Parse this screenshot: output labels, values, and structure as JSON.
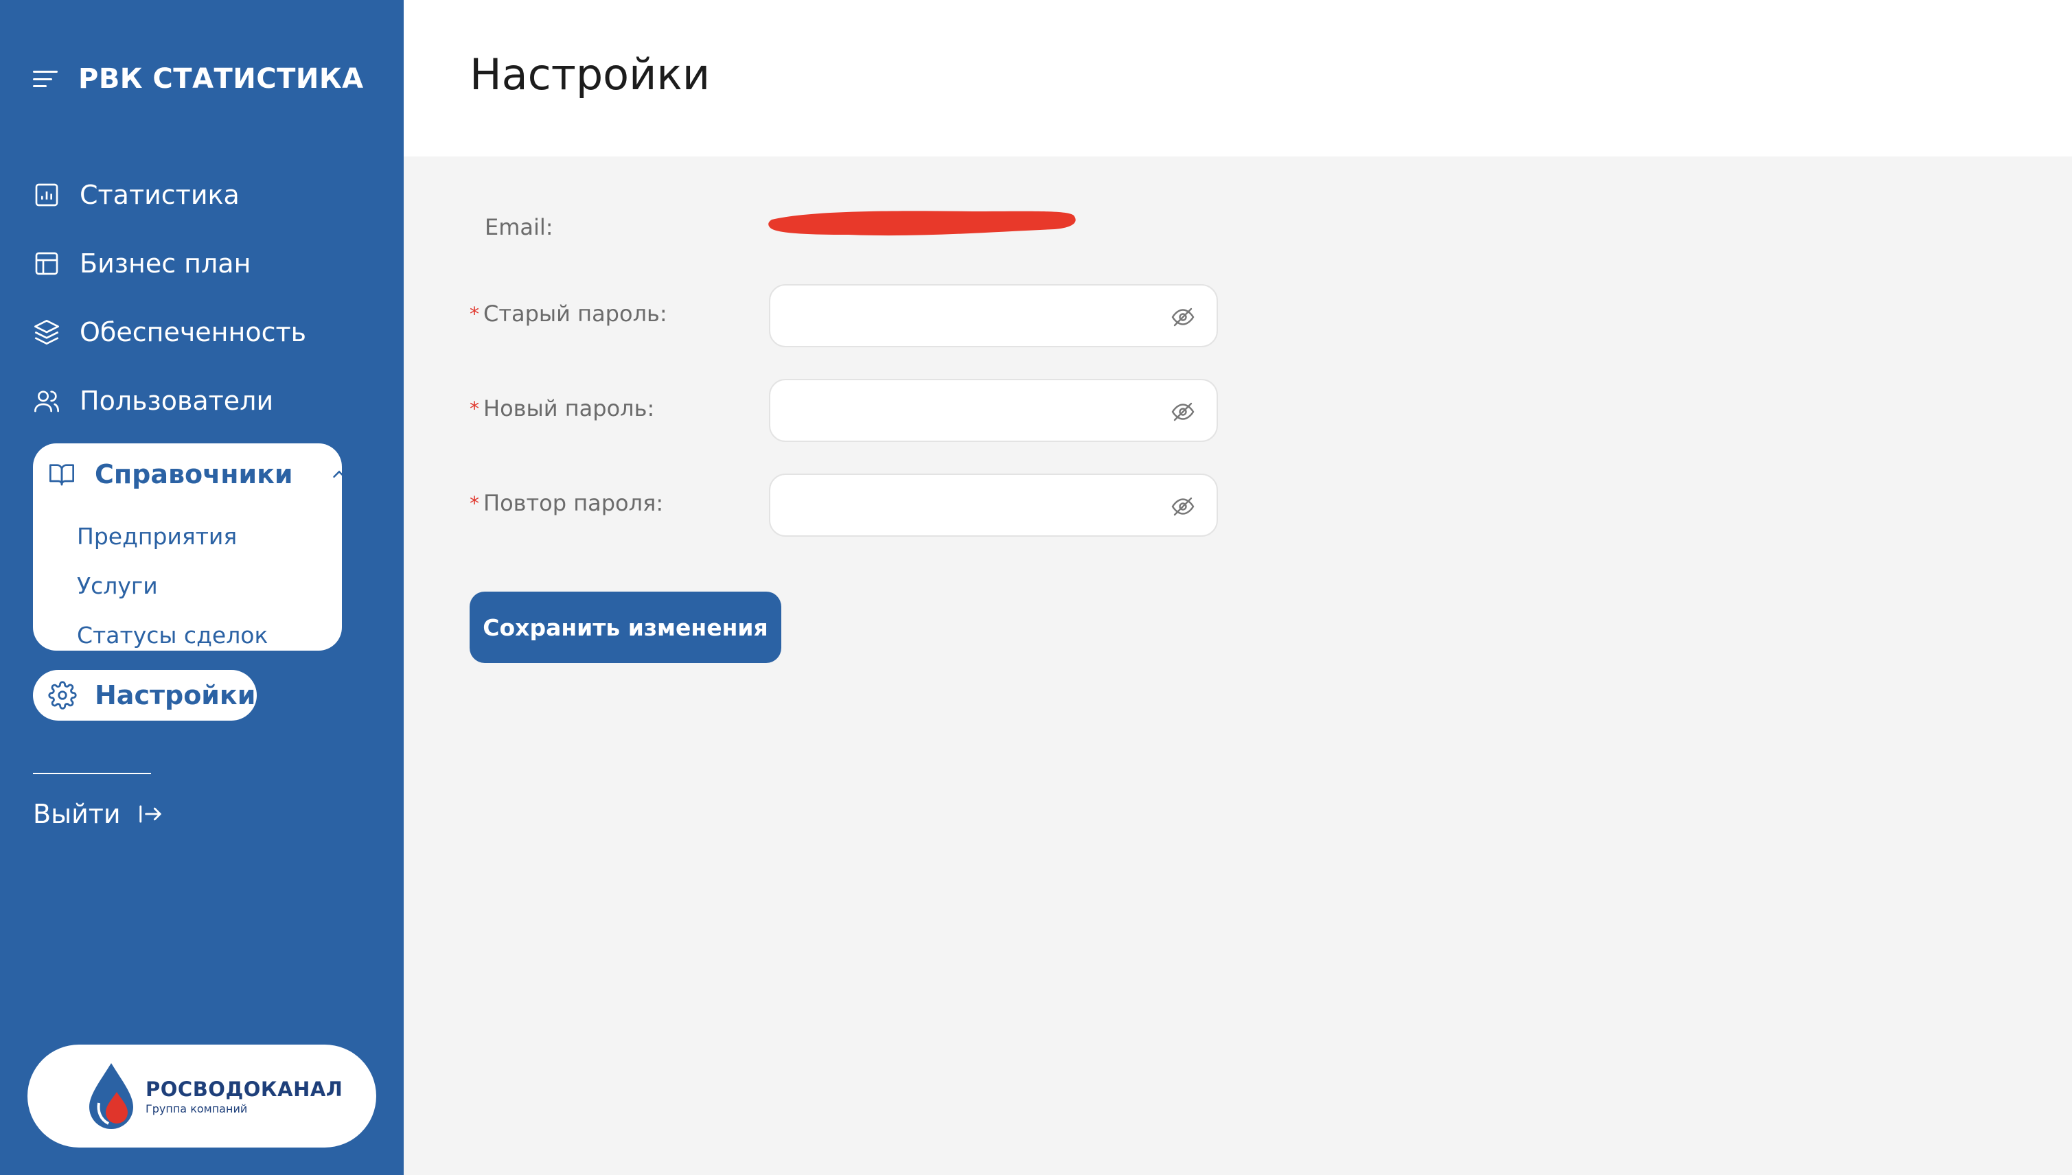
{
  "brand": {
    "title": "РВК СТАТИСТИКА"
  },
  "nav": {
    "items": [
      {
        "label": "Статистика",
        "icon": "bar-chart-icon"
      },
      {
        "label": "Бизнес план",
        "icon": "layout-icon"
      },
      {
        "label": "Обеспеченность",
        "icon": "layers-icon"
      },
      {
        "label": "Пользователи",
        "icon": "users-icon"
      }
    ],
    "references": {
      "label": "Справочники",
      "icon": "book-open-icon",
      "expanded": true,
      "items": [
        "Предприятия",
        "Услуги",
        "Статусы сделок"
      ]
    },
    "settings": {
      "label": "Настройки",
      "icon": "gear-icon",
      "active": true
    },
    "logout": {
      "label": "Выйти",
      "icon": "logout-icon"
    }
  },
  "logo": {
    "title": "РОСВОДОКАНАЛ",
    "subtitle": "Группа компаний"
  },
  "page": {
    "title": "Настройки"
  },
  "form": {
    "email_label": "Email:",
    "email_value_redacted": true,
    "fields": [
      {
        "label": "Старый пароль:",
        "required": true,
        "value": "",
        "placeholder": ""
      },
      {
        "label": "Новый пароль:",
        "required": true,
        "value": "",
        "placeholder": ""
      },
      {
        "label": "Повтор пароля:",
        "required": true,
        "value": "",
        "placeholder": ""
      }
    ],
    "required_mark": "*",
    "submit_label": "Сохранить изменения"
  },
  "colors": {
    "sidebar_bg": "#2b62a4",
    "accent": "#2b62a4",
    "content_bg": "#f4f4f4",
    "required": "#e0352b",
    "redaction": "#e8392a"
  }
}
